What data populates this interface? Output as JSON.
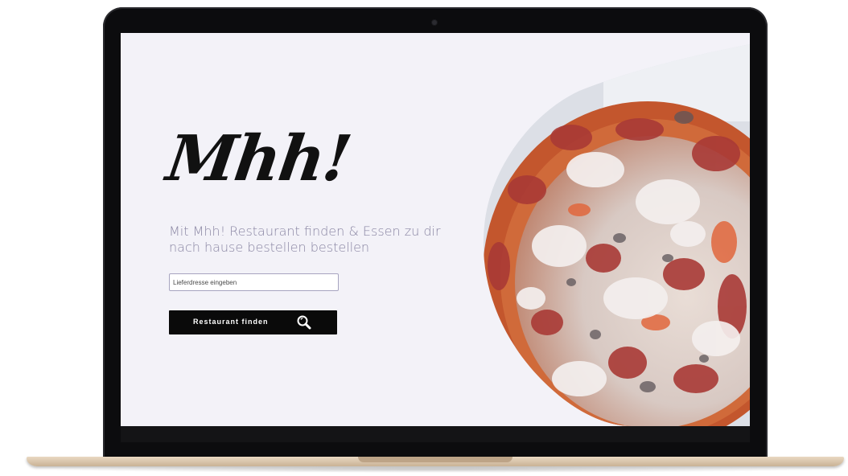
{
  "hero": {
    "logo_text": "Mhh!",
    "tagline": "Mit Mhh! Restaurant finden & Essen zu dir nach hause bestellen bestellen"
  },
  "search": {
    "placeholder": "Lieferdresse eingeben",
    "button_label": "Restaurant finden",
    "button_icon": "search-icon"
  },
  "colors": {
    "screen_background": "#f3f2f8",
    "tagline": "#8a86a3",
    "button_background": "#0a0a0a",
    "button_text": "#ffffff",
    "laptop_frame": "#0c0c0e",
    "laptop_base": "#e0ccb2"
  }
}
